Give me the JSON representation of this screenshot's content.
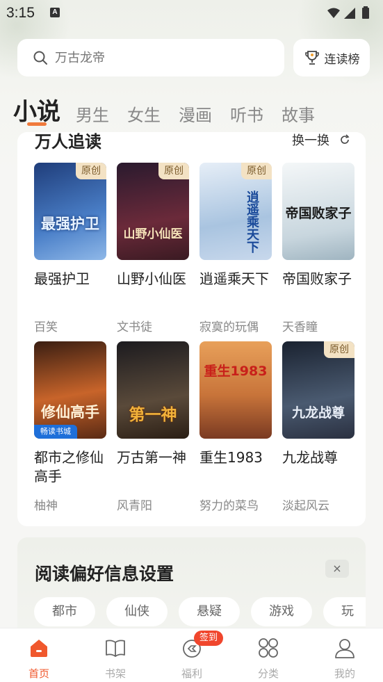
{
  "status_bar": {
    "time": "3:15",
    "notification_letter": "A"
  },
  "search": {
    "placeholder": "万古龙帝"
  },
  "rank_button": {
    "label": "连读榜"
  },
  "tabs": [
    {
      "label": "小说",
      "active": true
    },
    {
      "label": "男生"
    },
    {
      "label": "女生"
    },
    {
      "label": "漫画"
    },
    {
      "label": "听书"
    },
    {
      "label": "故事"
    }
  ],
  "section": {
    "title": "万人追读",
    "refresh_label": "换一换"
  },
  "books": [
    {
      "title": "最强护卫",
      "author": "百笑",
      "original": true,
      "cover_text": "最强护卫",
      "cover_colors": [
        "#1f3d7a",
        "#4a7fc8"
      ],
      "tag": "原创"
    },
    {
      "title": "山野小仙医",
      "author": "文书徒",
      "original": true,
      "cover_text": "山野小仙医",
      "cover_colors": [
        "#2a1a2e",
        "#6b2a3a"
      ],
      "tag": "原创"
    },
    {
      "title": "逍遥乘天下",
      "author": "寂寞的玩偶",
      "original": true,
      "cover_text": "逍遥乘天下",
      "cover_colors": [
        "#a9c4e0",
        "#e6eef7"
      ],
      "tag": "原创"
    },
    {
      "title": "帝国败家子",
      "author": "天香瞳",
      "original": false,
      "cover_text": "帝国败家子",
      "cover_colors": [
        "#e8eef2",
        "#c8d6de"
      ]
    },
    {
      "title": "都市之修仙高手",
      "author": "柚神",
      "original": false,
      "cover_text": "修仙高手",
      "cover_colors": [
        "#3a1e12",
        "#c8642a"
      ],
      "publisher": "畅读书城"
    },
    {
      "title": "万古第一神",
      "author": "风青阳",
      "original": false,
      "cover_text": "第一神",
      "cover_colors": [
        "#1c1b1f",
        "#5a4a3a"
      ]
    },
    {
      "title": "重生1983",
      "author": "努力的菜鸟",
      "original": false,
      "cover_text": "重生1983",
      "cover_colors": [
        "#e8a05a",
        "#7a3a22"
      ]
    },
    {
      "title": "九龙战尊",
      "author": "淡起风云",
      "original": true,
      "cover_text": "九龙战尊",
      "cover_colors": [
        "#1a2230",
        "#4a5a70"
      ],
      "tag": "原创"
    }
  ],
  "preference": {
    "title": "阅读偏好信息设置",
    "close_icon": "×",
    "chips": [
      "都市",
      "仙侠",
      "悬疑",
      "游戏",
      "玩"
    ]
  },
  "bottom_nav": [
    {
      "label": "首页",
      "icon": "home-icon",
      "active": true
    },
    {
      "label": "书架",
      "icon": "book-icon"
    },
    {
      "label": "福利",
      "icon": "gift-icon",
      "badge": "签到"
    },
    {
      "label": "分类",
      "icon": "grid-icon"
    },
    {
      "label": "我的",
      "icon": "user-icon"
    }
  ],
  "colors": {
    "accent": "#f07a3c",
    "nav_active": "#f0582d",
    "badge": "#f0462d"
  }
}
